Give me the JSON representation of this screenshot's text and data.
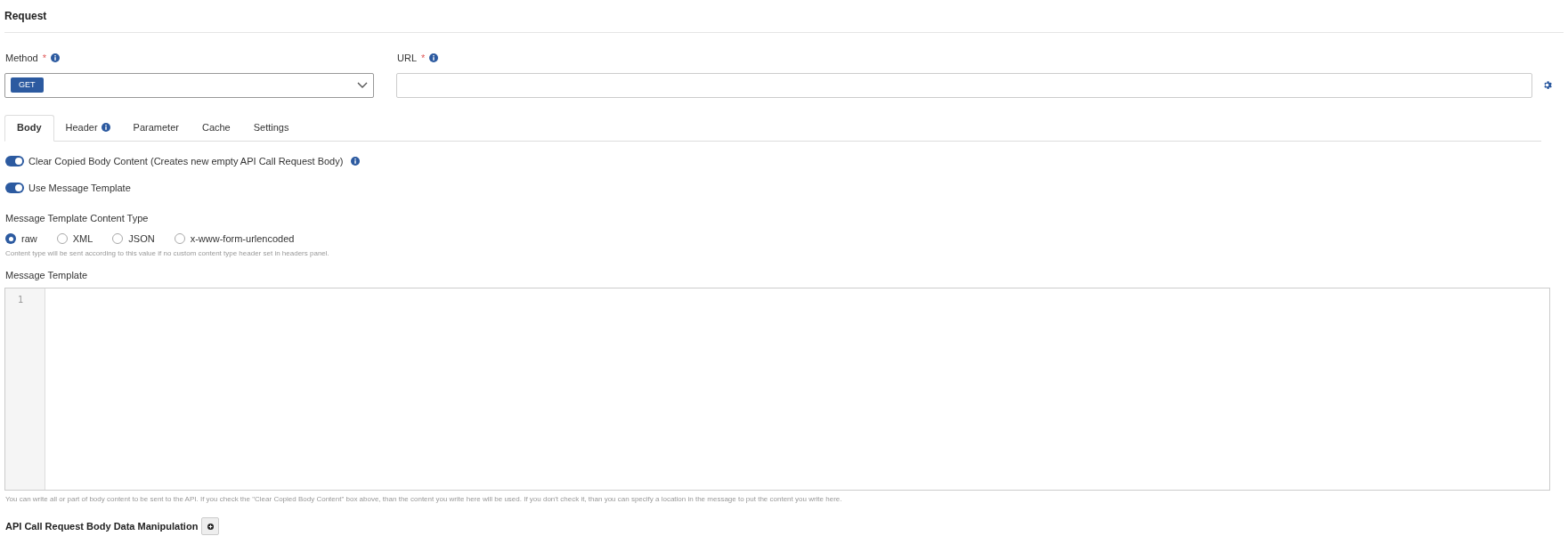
{
  "section_title": "Request",
  "method": {
    "label": "Method",
    "required_mark": "*",
    "value": "GET"
  },
  "url": {
    "label": "URL",
    "required_mark": "*"
  },
  "tabs": [
    {
      "label": "Body",
      "selected": true,
      "info": false
    },
    {
      "label": "Header",
      "selected": false,
      "info": true
    },
    {
      "label": "Parameter",
      "selected": false,
      "info": false
    },
    {
      "label": "Cache",
      "selected": false,
      "info": false
    },
    {
      "label": "Settings",
      "selected": false,
      "info": false
    }
  ],
  "toggles": [
    {
      "label": "Clear Copied Body Content (Creates new empty API Call Request Body)",
      "on": true,
      "info": true
    },
    {
      "label": "Use Message Template",
      "on": true,
      "info": false
    }
  ],
  "content_type": {
    "label": "Message Template Content Type",
    "options": [
      {
        "label": "raw",
        "selected": true
      },
      {
        "label": "XML",
        "selected": false
      },
      {
        "label": "JSON",
        "selected": false
      },
      {
        "label": "x-www-form-urlencoded",
        "selected": false
      }
    ],
    "hint": "Content type will be sent according to this value if no custom content type header set in headers panel."
  },
  "template": {
    "label": "Message Template",
    "line_numbers": [
      "1"
    ],
    "hint": "You can write all or part of body content to be sent to the API. If you check the \"Clear Copied Body Content\" box above, than the content you write here will be used. If you don't check it, than you can specify a location in the message to put the content you write here."
  },
  "manipulation": {
    "title": "API Call Request Body Data Manipulation"
  }
}
